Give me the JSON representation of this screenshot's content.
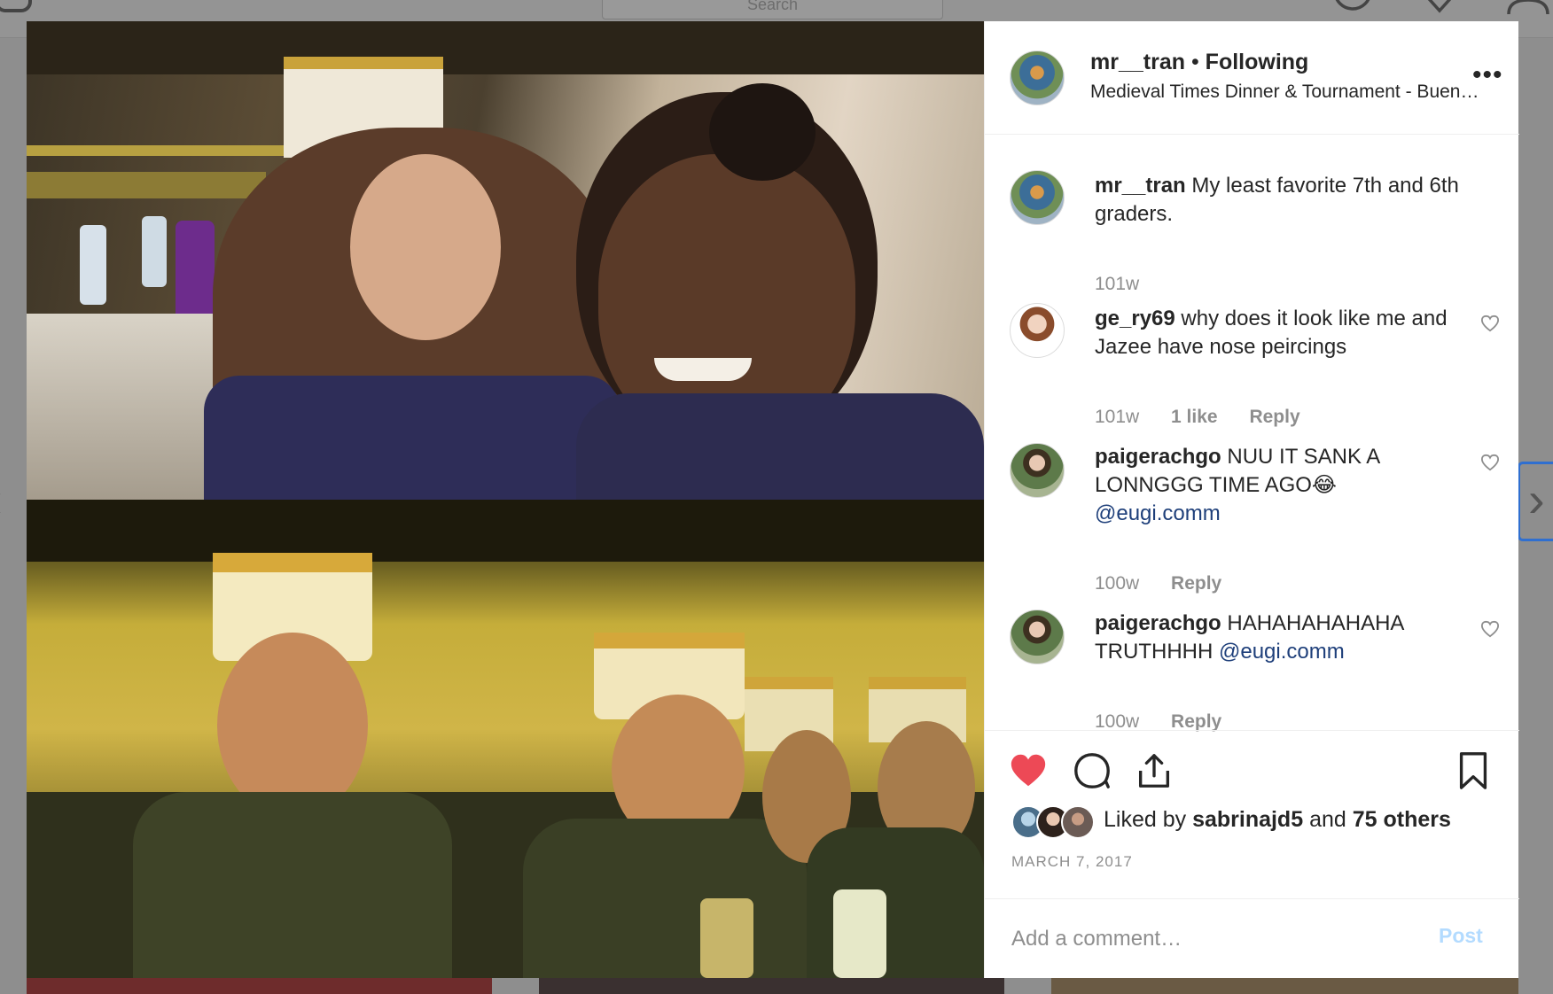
{
  "background": {
    "search_placeholder": "Search"
  },
  "post": {
    "author": "mr__tran",
    "separator": "•",
    "follow_status": "Following",
    "location": "Medieval Times Dinner & Tournament - Buena Park",
    "more_label": "•••"
  },
  "caption": {
    "username": "mr__tran",
    "text": " My least favorite 7th and 6th graders.",
    "age": "101w"
  },
  "comments": [
    {
      "username": "ge_ry69",
      "text": " why does it look like me and Jazee have nose peircings",
      "mention": "",
      "age": "101w",
      "likes": "1 like",
      "reply": "Reply"
    },
    {
      "username": "paigerachgo",
      "text": " NUU IT SANK A LONNGGG TIME AGO😂 ",
      "mention": "@eugi.comm",
      "age": "100w",
      "likes": "",
      "reply": "Reply"
    },
    {
      "username": "paigerachgo",
      "text": " HAHAHAHAHAHA TRUTHHHH ",
      "mention": "@eugi.comm",
      "age": "100w",
      "likes": "",
      "reply": "Reply"
    }
  ],
  "likes": {
    "prefix": "Liked by ",
    "user": "sabrinajd5",
    "middle": " and ",
    "others": "75 others"
  },
  "date": "MARCH 7, 2017",
  "add_comment": {
    "placeholder": "Add a comment…",
    "post_label": "Post"
  },
  "colors": {
    "like_red": "#ed4956",
    "mention_blue": "#1e3f7a",
    "post_disabled": "#b3dbff"
  },
  "icons": {
    "like": "heart-icon",
    "comment": "comment-icon",
    "share": "share-icon",
    "save": "bookmark-icon"
  }
}
